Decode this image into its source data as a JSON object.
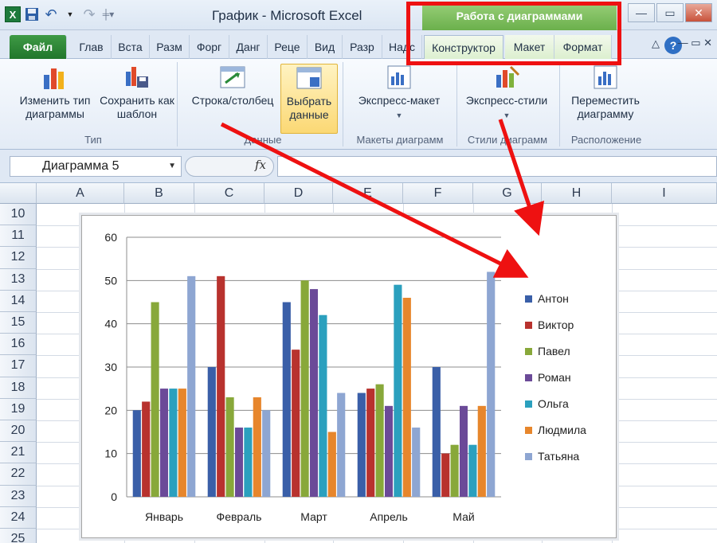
{
  "window": {
    "title": "График - Microsoft Excel",
    "context_group": "Работа с диаграммами",
    "app_logo": "X"
  },
  "tabs": [
    {
      "label": "Файл"
    },
    {
      "label": "Глав"
    },
    {
      "label": "Вста"
    },
    {
      "label": "Разм"
    },
    {
      "label": "Форг"
    },
    {
      "label": "Данг"
    },
    {
      "label": "Реце"
    },
    {
      "label": "Вид"
    },
    {
      "label": "Разр"
    },
    {
      "label": "Надс"
    },
    {
      "label": "Конструктор"
    },
    {
      "label": "Макет"
    },
    {
      "label": "Формат"
    }
  ],
  "ribbon": {
    "change_type": "Изменить тип диаграммы",
    "save_template": "Сохранить как шаблон",
    "group_type": "Тип",
    "switch_row_col": "Строка/столбец",
    "select_data": "Выбрать данные",
    "group_data": "Данные",
    "quick_layout": "Экспресс-макет",
    "group_layouts": "Макеты диаграмм",
    "quick_styles": "Экспресс-стили",
    "group_styles": "Стили диаграмм",
    "move_chart": "Переместить диаграмму",
    "group_location": "Расположение"
  },
  "formula_bar": {
    "name_box": "Диаграмма 5",
    "fx": "fx"
  },
  "grid": {
    "columns": [
      "A",
      "B",
      "C",
      "D",
      "E",
      "F",
      "G",
      "H",
      "I"
    ],
    "rows": [
      "10",
      "11",
      "12",
      "13",
      "14",
      "15",
      "16",
      "17",
      "18",
      "19",
      "20",
      "21",
      "22",
      "23",
      "24",
      "25"
    ]
  },
  "chart_data": {
    "type": "bar",
    "categories": [
      "Январь",
      "Февраль",
      "Март",
      "Апрель",
      "Май"
    ],
    "ylim": [
      0,
      60
    ],
    "yticks": [
      0,
      10,
      20,
      30,
      40,
      50,
      60
    ],
    "legend_position": "right",
    "grid": true,
    "series": [
      {
        "name": "Антон",
        "color": "#3a5fa8",
        "values": [
          20,
          30,
          45,
          24,
          30
        ]
      },
      {
        "name": "Виктор",
        "color": "#b8322e",
        "values": [
          22,
          51,
          34,
          25,
          10
        ]
      },
      {
        "name": "Павел",
        "color": "#88a83a",
        "values": [
          45,
          23,
          50,
          26,
          12
        ]
      },
      {
        "name": "Роман",
        "color": "#6b4a98",
        "values": [
          25,
          16,
          48,
          21,
          21
        ]
      },
      {
        "name": "Ольга",
        "color": "#2ba0be",
        "values": [
          25,
          16,
          42,
          49,
          12
        ]
      },
      {
        "name": "Людмила",
        "color": "#e7862c",
        "values": [
          25,
          23,
          15,
          46,
          21
        ]
      },
      {
        "name": "Татьяна",
        "color": "#8ea6d2",
        "values": [
          51,
          20,
          24,
          16,
          52
        ]
      }
    ]
  },
  "annotation": {
    "highlight_color": "#ee1111"
  }
}
